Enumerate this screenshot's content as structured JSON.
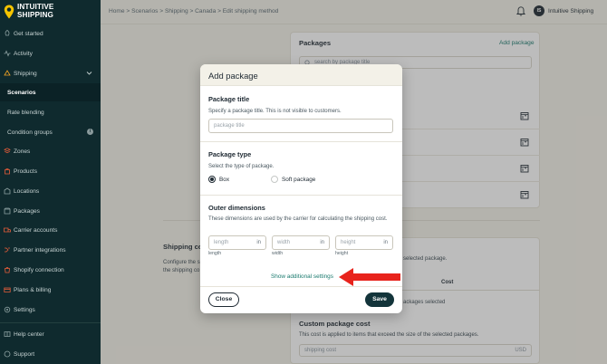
{
  "brand": {
    "name_line1": "INTUITIVE",
    "name_line2": "SHIPPING",
    "accent": "#f5c400"
  },
  "sidebar": {
    "items": [
      {
        "label": "Get started",
        "icon": "rocket-icon"
      },
      {
        "label": "Activity",
        "icon": "activity-icon"
      },
      {
        "label": "Shipping",
        "icon": "shipping-icon"
      },
      {
        "label": "Scenarios",
        "icon": ""
      },
      {
        "label": "Rate blending",
        "icon": ""
      },
      {
        "label": "Condition groups",
        "icon": "info-icon"
      },
      {
        "label": "Zones",
        "icon": "zones-icon"
      },
      {
        "label": "Products",
        "icon": "products-icon"
      },
      {
        "label": "Locations",
        "icon": "locations-icon"
      },
      {
        "label": "Packages",
        "icon": "packages-icon"
      },
      {
        "label": "Carrier accounts",
        "icon": "carrier-icon"
      },
      {
        "label": "Partner integrations",
        "icon": "partner-icon"
      },
      {
        "label": "Shopify connection",
        "icon": "shopify-icon"
      },
      {
        "label": "Plans & billing",
        "icon": "billing-icon"
      },
      {
        "label": "Settings",
        "icon": "gear-icon"
      },
      {
        "label": "Help center",
        "icon": "help-icon"
      },
      {
        "label": "Support",
        "icon": "support-icon"
      }
    ]
  },
  "topbar": {
    "breadcrumb": [
      "Home",
      "Scenarios",
      "Shipping",
      "Canada",
      "Edit shipping method"
    ],
    "separator": " > ",
    "avatar_initials": "IS",
    "account_name": "Intuitive Shipping"
  },
  "background": {
    "packages_title": "Packages",
    "add_package_link": "Add package",
    "search_placeholder": "search by package title",
    "shipping_cost_title": "Shipping co",
    "shipping_cost_desc_1": "Configure the s",
    "shipping_cost_desc_2": "the shipping co",
    "selected_package_text": "selected package.",
    "cost_header": "Cost",
    "packages_selected_text": "ackages selected",
    "custom_cost_title": "Custom package cost",
    "custom_cost_desc": "This cost is applied to items that exceed the size of the selected packages.",
    "shipping_cost_placeholder": "shipping cost",
    "currency": "USD"
  },
  "modal": {
    "title": "Add package",
    "package_title": {
      "heading": "Package title",
      "description": "Specify a package title. This is not visible to customers.",
      "placeholder": "package title"
    },
    "package_type": {
      "heading": "Package type",
      "description": "Select the type of package.",
      "options": [
        {
          "label": "Box",
          "selected": true
        },
        {
          "label": "Soft package",
          "selected": false
        }
      ]
    },
    "outer_dimensions": {
      "heading": "Outer dimensions",
      "description": "These dimensions are used by the carrier for calculating the shipping cost.",
      "fields": [
        {
          "placeholder": "length",
          "unit": "in",
          "label": "length"
        },
        {
          "placeholder": "width",
          "unit": "in",
          "label": "width"
        },
        {
          "placeholder": "height",
          "unit": "in",
          "label": "height"
        }
      ]
    },
    "show_settings_link": "Show additional settings",
    "close_label": "Close",
    "save_label": "Save"
  },
  "colors": {
    "sidebar_bg": "#0f2a2e",
    "primary": "#13343a",
    "link": "#1a7a6e",
    "annotation_arrow": "#e8231c"
  }
}
